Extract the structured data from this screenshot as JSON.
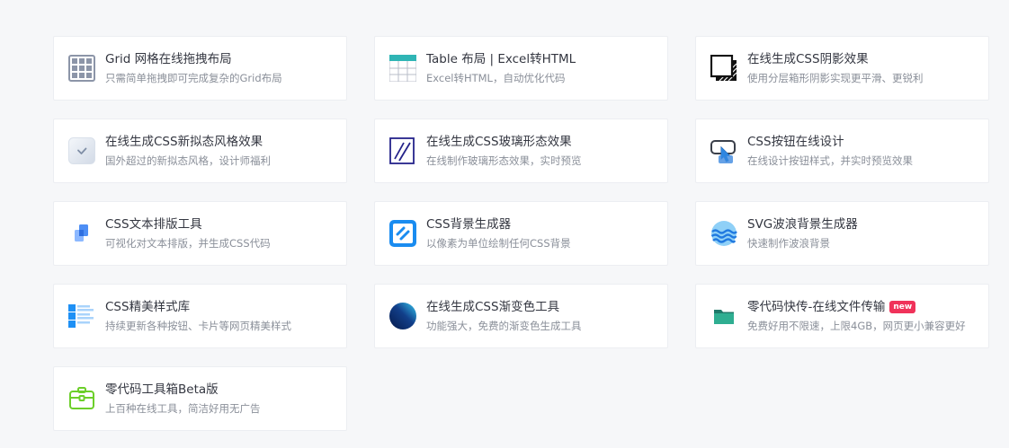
{
  "cards": [
    {
      "icon": "grid-layout-icon",
      "title": "Grid 网格在线拖拽布局",
      "desc": "只需简单拖拽即可完成复杂的Grid布局"
    },
    {
      "icon": "table-icon",
      "title": "Table 布局 | Excel转HTML",
      "desc": "Excel转HTML，自动优化代码"
    },
    {
      "icon": "box-shadow-icon",
      "title": "在线生成CSS阴影效果",
      "desc": "使用分层箱形阴影实现更平滑、更锐利"
    },
    {
      "icon": "neumorphism-icon",
      "title": "在线生成CSS新拟态风格效果",
      "desc": "国外超过的新拟态风格，设计师福利"
    },
    {
      "icon": "glassmorphism-icon",
      "title": "在线生成CSS玻璃形态效果",
      "desc": "在线制作玻璃形态效果，实时预览"
    },
    {
      "icon": "button-design-icon",
      "title": "CSS按钮在线设计",
      "desc": "在线设计按钮样式，并实时预览效果"
    },
    {
      "icon": "text-layout-icon",
      "title": "CSS文本排版工具",
      "desc": "可视化对文本排版，并生成CSS代码"
    },
    {
      "icon": "background-generator-icon",
      "title": "CSS背景生成器",
      "desc": "以像素为单位绘制任何CSS背景"
    },
    {
      "icon": "svg-wave-icon",
      "title": "SVG波浪背景生成器",
      "desc": "快速制作波浪背景"
    },
    {
      "icon": "style-library-icon",
      "title": "CSS精美样式库",
      "desc": "持续更新各种按钮、卡片等网页精美样式"
    },
    {
      "icon": "gradient-icon",
      "title": "在线生成CSS渐变色工具",
      "desc": "功能强大，免费的渐变色生成工具"
    },
    {
      "icon": "folder-icon",
      "title": "零代码快传-在线文件传输",
      "desc": "免费好用不限速，上限4GB，网页更小兼容更好",
      "badge": "new"
    },
    {
      "icon": "toolbox-icon",
      "title": "零代码工具箱Beta版",
      "desc": "上百种在线工具，简洁好用无广告"
    }
  ]
}
